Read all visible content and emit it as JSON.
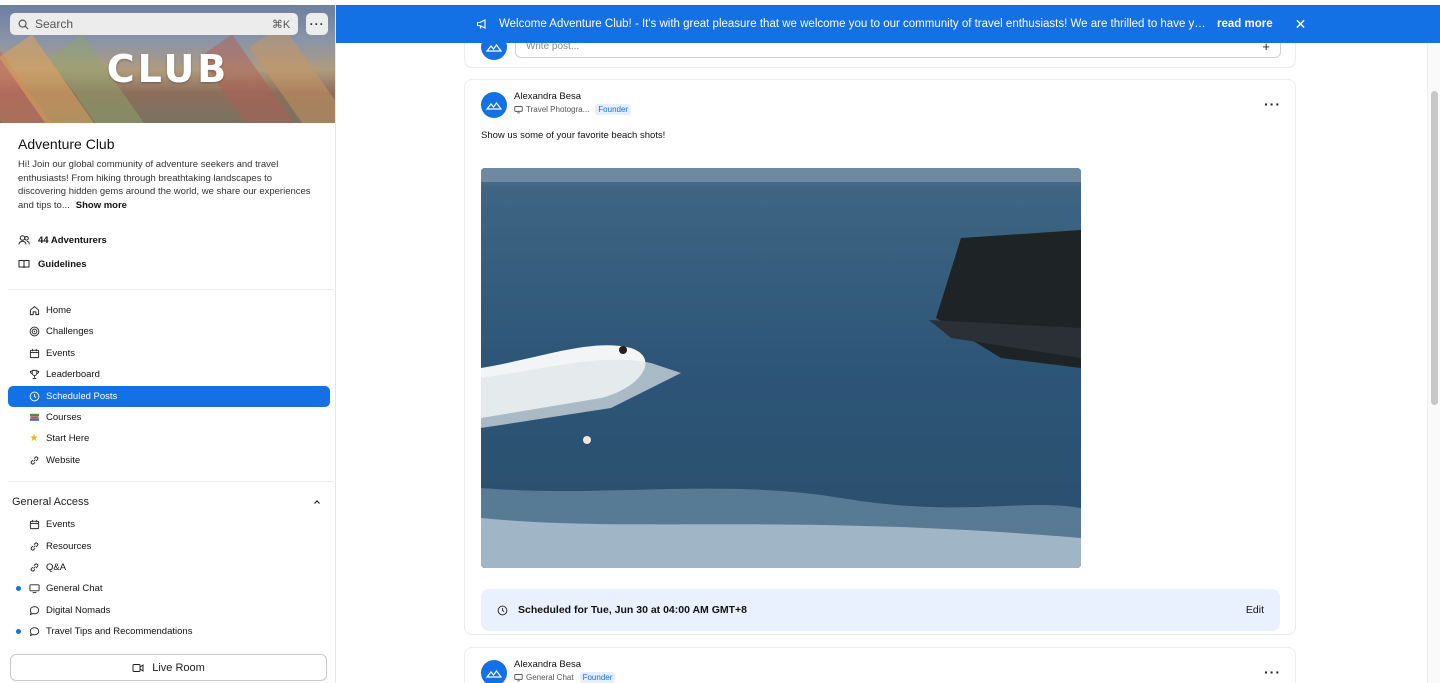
{
  "search": {
    "placeholder": "Search",
    "shortcut": "⌘K"
  },
  "community": {
    "banner_text": "CLUB",
    "name": "Adventure Club",
    "description": "Hi! Join our global community of adventure seekers and travel enthusiasts! From hiking through breathtaking landscapes to discovering hidden gems around the world, we share our experiences and tips to...",
    "show_more": "Show more",
    "members": "44 Adventurers",
    "guidelines": "Guidelines"
  },
  "nav": {
    "items": [
      {
        "label": "Home",
        "icon": "home-icon"
      },
      {
        "label": "Challenges",
        "icon": "target-icon"
      },
      {
        "label": "Events",
        "icon": "calendar-icon"
      },
      {
        "label": "Leaderboard",
        "icon": "trophy-icon"
      },
      {
        "label": "Scheduled Posts",
        "icon": "clock-icon",
        "active": true
      },
      {
        "label": "Courses",
        "icon": "books-icon"
      },
      {
        "label": "Start Here",
        "icon": "star-icon"
      },
      {
        "label": "Website",
        "icon": "link-icon"
      }
    ]
  },
  "general_access": {
    "title": "General Access",
    "items": [
      {
        "label": "Events",
        "icon": "calendar-icon"
      },
      {
        "label": "Resources",
        "icon": "link-icon"
      },
      {
        "label": "Q&A",
        "icon": "link-icon"
      },
      {
        "label": "General Chat",
        "icon": "monitor-icon",
        "unread": true
      },
      {
        "label": "Digital Nomads",
        "icon": "chat-icon"
      },
      {
        "label": "Travel Tips and Recommendations",
        "icon": "chat-icon",
        "unread": true
      }
    ]
  },
  "live_room": "Live Room",
  "announcement": {
    "text": "Welcome Adventure Club! - It's with great pleasure that we welcome you to our community of travel enthusiasts! We are thrilled to have you here...",
    "read_more": "read more"
  },
  "composer": {
    "placeholder": "Write post..."
  },
  "posts": [
    {
      "author": "Alexandra Besa",
      "channel": "Travel Photogra...",
      "badge": "Founder",
      "text": "Show us some of your favorite beach shots!",
      "scheduled": "Scheduled for Tue, Jun 30 at 04:00 AM GMT+8",
      "edit": "Edit"
    },
    {
      "author": "Alexandra Besa",
      "channel": "General Chat",
      "badge": "Founder"
    }
  ],
  "colors": {
    "accent": "#1470e5",
    "schedule_bg": "#e8f1fd"
  }
}
